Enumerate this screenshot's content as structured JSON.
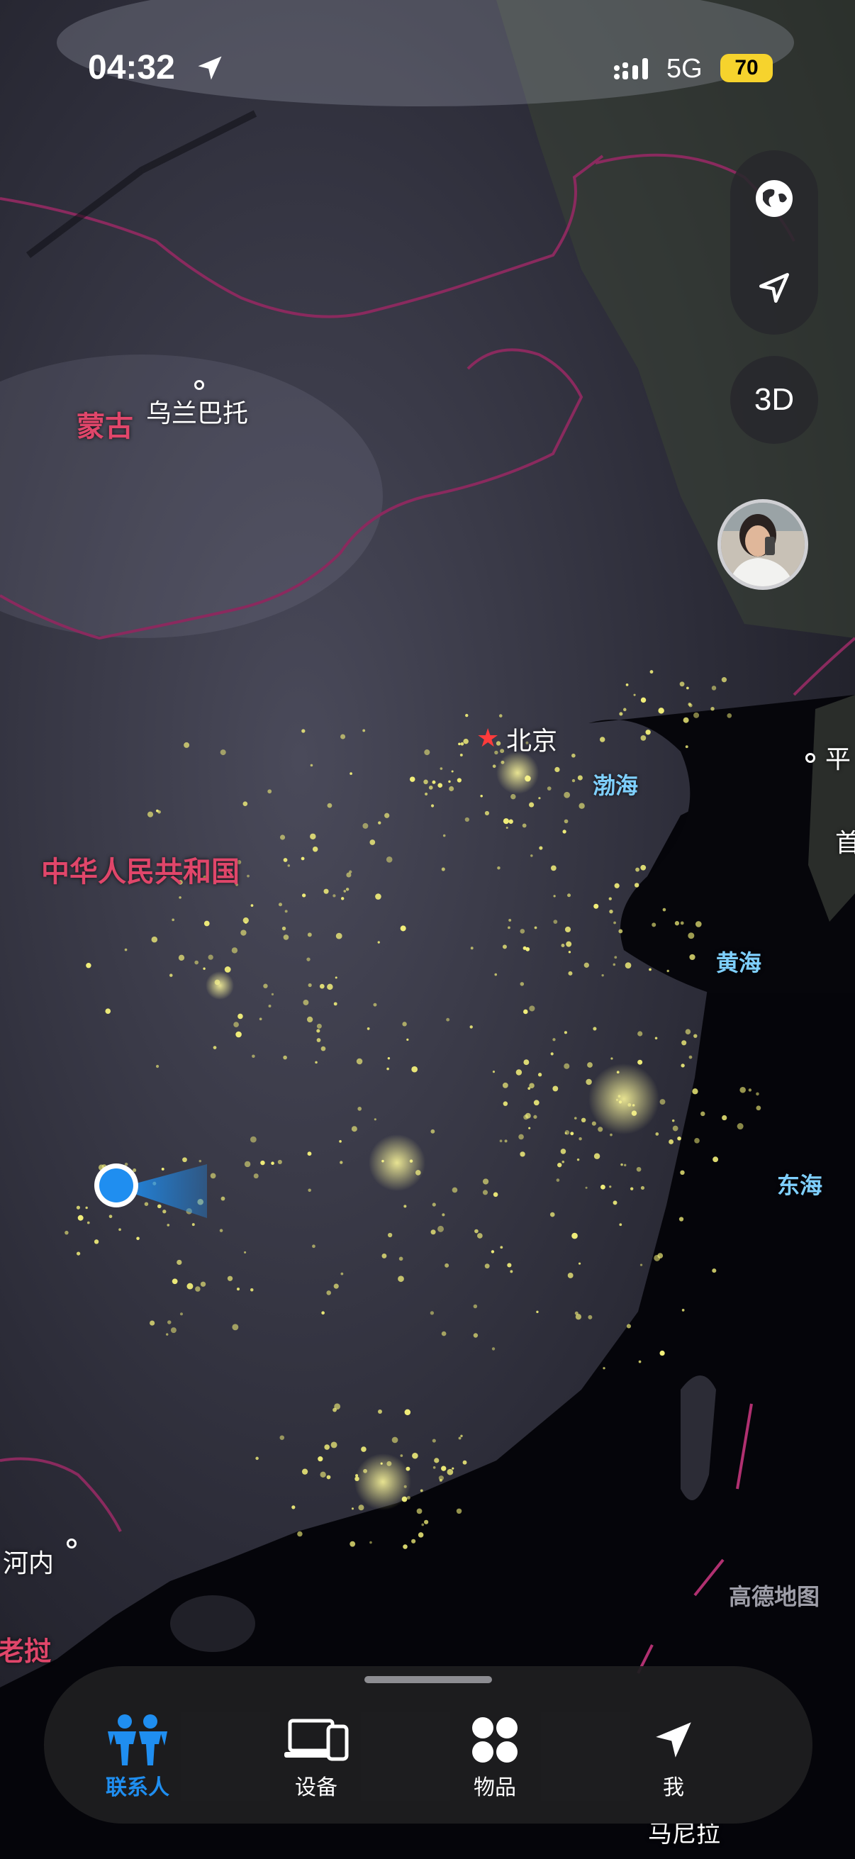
{
  "status_bar": {
    "time": "04:32",
    "network": "5G",
    "battery": "70"
  },
  "map": {
    "countries": [
      "蒙古",
      "中华人民共和国"
    ],
    "cities": [
      "乌兰巴托",
      "北京",
      "河内",
      "老挝",
      "平",
      "首"
    ],
    "seas": [
      "渤海",
      "黄海",
      "东海"
    ],
    "watermark": "高德地图",
    "bottom_partial": "马尼拉"
  },
  "controls": {
    "mode_3d": "3D"
  },
  "tabs": [
    {
      "label": "联系人",
      "icon": "people-icon",
      "active": true
    },
    {
      "label": "设备",
      "icon": "devices-icon",
      "active": false
    },
    {
      "label": "物品",
      "icon": "items-icon",
      "active": false
    },
    {
      "label": "我",
      "icon": "location-arrow-icon",
      "active": false
    }
  ],
  "colors": {
    "active_tab": "#1f8ef0",
    "border": "#8a2a5e",
    "city_lights": "#f3f07a",
    "user_location": "#1f8ef0"
  }
}
